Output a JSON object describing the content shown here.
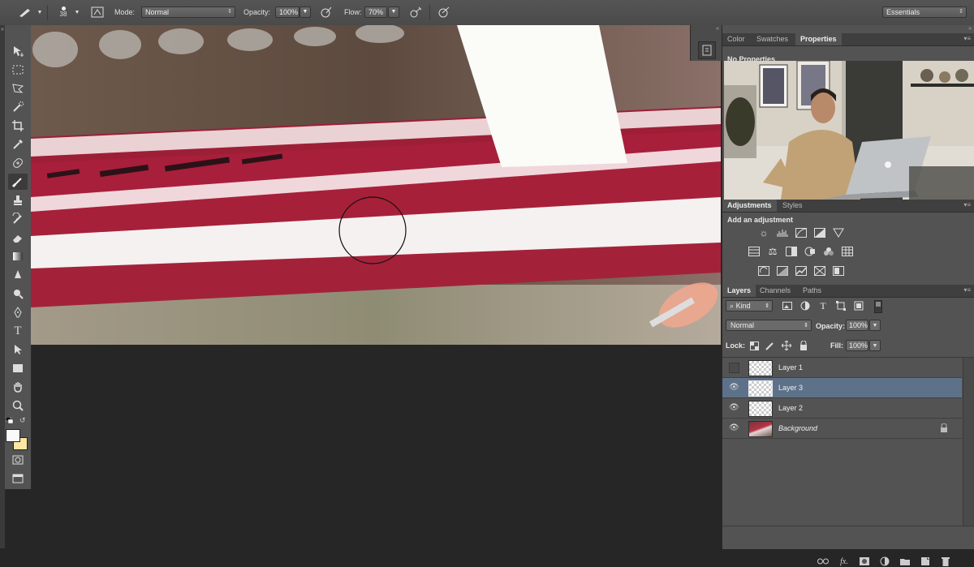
{
  "options_bar": {
    "brush_size": "38",
    "mode_label": "Mode:",
    "mode_value": "Normal",
    "opacity_label": "Opacity:",
    "opacity_value": "100%",
    "flow_label": "Flow:",
    "flow_value": "70%",
    "workspace": "Essentials"
  },
  "top_panel": {
    "tabs": [
      "Color",
      "Swatches",
      "Properties"
    ],
    "selected_tab": "Properties",
    "message": "No Properties"
  },
  "adjustments_panel": {
    "tabs": [
      "Adjustments",
      "Styles"
    ],
    "heading": "Add an adjustment",
    "icons": [
      "brightness-contrast-icon",
      "levels-icon",
      "curves-icon",
      "exposure-icon",
      "vibrance-icon",
      "hue-saturation-icon",
      "color-balance-icon",
      "black-white-icon",
      "photo-filter-icon",
      "channel-mixer-icon",
      "color-lookup-icon",
      "invert-icon",
      "posterize-icon",
      "threshold-icon",
      "gradient-map-icon",
      "selective-color-icon"
    ]
  },
  "layers_panel": {
    "tabs": [
      "Layers",
      "Channels",
      "Paths"
    ],
    "filter_label": "Kind",
    "blend_mode": "Normal",
    "opacity_label": "Opacity:",
    "opacity_value": "100%",
    "lock_label": "Lock:",
    "fill_label": "Fill:",
    "fill_value": "100%",
    "layers": [
      {
        "name": "Layer 1",
        "visible": false,
        "selected": false
      },
      {
        "name": "Layer 3",
        "visible": true,
        "selected": true
      },
      {
        "name": "Layer 2",
        "visible": true,
        "selected": false
      },
      {
        "name": "Background",
        "visible": true,
        "selected": false,
        "locked": true
      }
    ]
  },
  "colors": {
    "accent_selected_layer": "#5d7189",
    "panel_bg": "#535353",
    "app_bg": "#262626"
  }
}
